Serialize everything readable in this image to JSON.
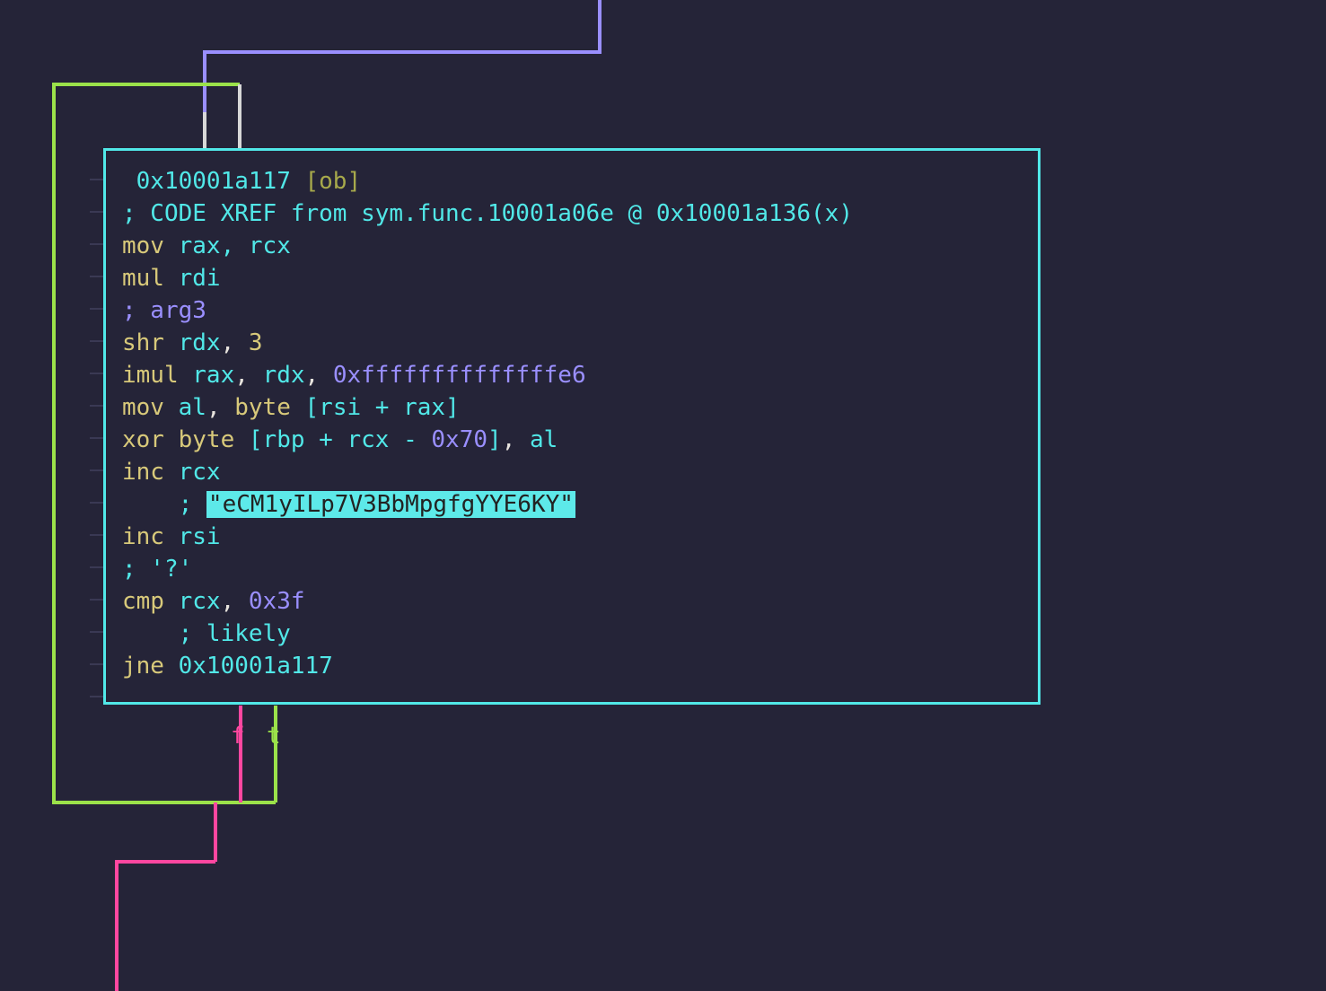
{
  "colors": {
    "bg": "#252438",
    "border": "#51e8e8",
    "flow_purple": "#9a8fff",
    "flow_green": "#9be24a",
    "flow_magenta": "#ff47a0",
    "flow_cyan": "#51e8e8"
  },
  "block": {
    "addr": "0x10001a117",
    "tag": "[ob]",
    "xref": "; CODE XREF from sym.func.10001a06e @ 0x10001a136(x)",
    "lines": {
      "l1_mn": "mov",
      "l1_op": "rax, rcx",
      "l2_mn": "mul",
      "l2_op": "rdi",
      "l3_cm": "; arg3",
      "l4_mn": "shr",
      "l4_r": "rdx",
      "l4_n": "3",
      "l5_mn": "imul",
      "l5_r1": "rax",
      "l5_r2": "rdx",
      "l5_imm": "0xffffffffffffffe6",
      "l6_mn": "mov",
      "l6_dst": "al",
      "l6_byte": "byte",
      "l6_mem": "[rsi + rax]",
      "l7_mn": "xor",
      "l7_byte": "byte",
      "l7_mem_a": "[rbp + rcx - ",
      "l7_off": "0x70",
      "l7_mem_b": "]",
      "l7_src": "al",
      "l8_mn": "inc",
      "l8_op": "rcx",
      "l9_cm_pre": "    ; ",
      "l9_str": "\"eCM1yILp7V3BbMpgfgYYE6KY\"",
      "l10_mn": "inc",
      "l10_op": "rsi",
      "l11_cm": "; '?'",
      "l12_mn": "cmp",
      "l12_r": "rcx",
      "l12_imm": "0x3f",
      "l13_cm": "    ; likely",
      "l14_mn": "jne",
      "l14_tgt": "0x10001a117"
    }
  },
  "branches": {
    "false_label": "f",
    "true_label": "t"
  }
}
